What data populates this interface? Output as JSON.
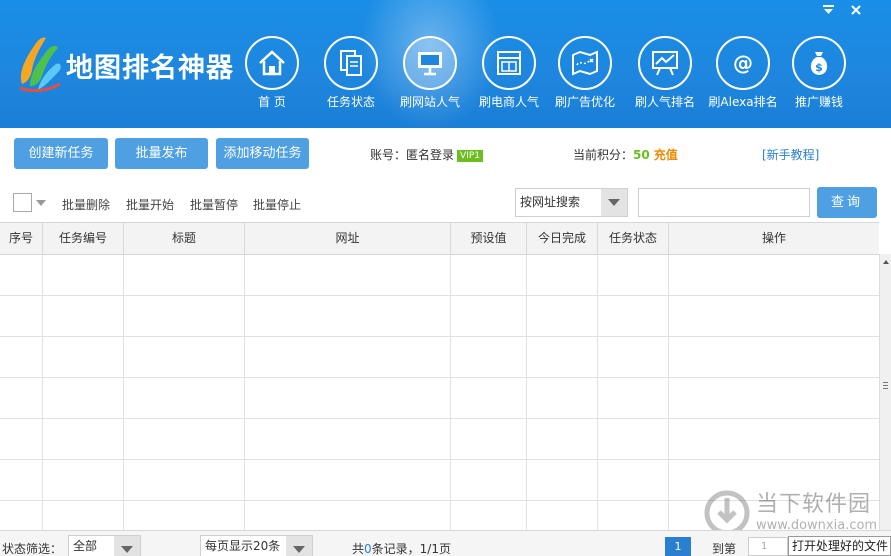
{
  "app": {
    "title": "地图排名神器"
  },
  "window": {
    "minimize_label": "▼",
    "close_label": "✕"
  },
  "nav": [
    {
      "label": "首  页",
      "icon": "home-icon"
    },
    {
      "label": "任务状态",
      "icon": "documents-icon"
    },
    {
      "label": "刷网站人气",
      "icon": "monitor-icon",
      "active": true
    },
    {
      "label": "刷电商人气",
      "icon": "store-icon"
    },
    {
      "label": "刷广告优化",
      "icon": "map-icon"
    },
    {
      "label": "刷人气排名",
      "icon": "chart-board-icon"
    },
    {
      "label": "刷Alexa排名",
      "icon": "at-icon"
    },
    {
      "label": "推广赚钱",
      "icon": "money-bag-icon"
    }
  ],
  "toolbar": {
    "create_task": "创建新任务",
    "batch_publish": "批量发布",
    "add_mobile_task": "添加移动任务"
  },
  "account": {
    "label": "账号：",
    "name": "匿名登录",
    "vip": "VIP1",
    "points_label": "当前积分：",
    "points": "50",
    "recharge": "充值",
    "help": "[新手教程]"
  },
  "batch": {
    "delete": "批量删除",
    "start": "批量开始",
    "pause": "批量暂停",
    "stop": "批量停止"
  },
  "search": {
    "mode": "按网址搜索",
    "value": "",
    "button": "查询"
  },
  "table": {
    "headers": [
      "序号",
      "任务编号",
      "标题",
      "网址",
      "预设值",
      "今日完成",
      "任务状态",
      "操作"
    ],
    "rows": []
  },
  "footer": {
    "filter_label": "状态筛选：",
    "filter_value": "全部",
    "per_page": "每页显示20条",
    "total_prefix": "共",
    "total_count": "0",
    "total_suffix": "条记录，1/1页",
    "current_page": "1",
    "goto_label": "到第",
    "goto_value": "1",
    "tooltip": "打开处理好的文件"
  },
  "watermark": {
    "text": "当下软件园",
    "url": "www.downxia.com"
  },
  "colors": {
    "header_blue": "#1a8ee6",
    "button_blue": "#4ea0e3",
    "vip_green": "#6cbd1f",
    "recharge_orange": "#f08a00",
    "link_blue": "#2b7fd1"
  }
}
